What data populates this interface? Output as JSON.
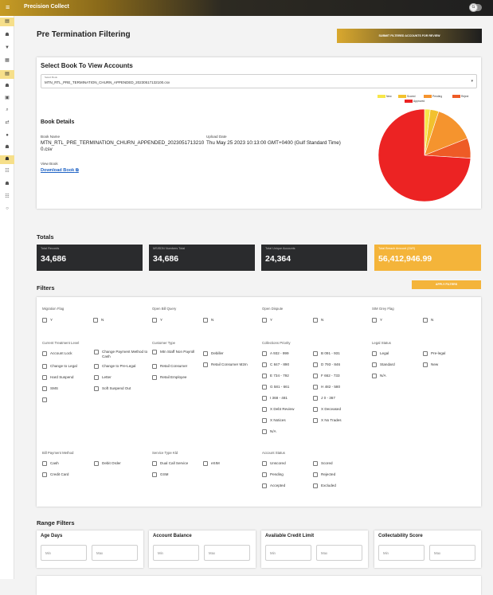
{
  "app": {
    "title": "Precision Collect",
    "avatar_initial": "G"
  },
  "page": {
    "title": "Pre Termination Filtering",
    "submit_label": "SUBMIT FILTERED ACCOUNTS FOR REVIEW"
  },
  "sidebar": {
    "icons": [
      "grid-icon",
      "user-icon",
      "filter-icon",
      "list-icon",
      "book-icon",
      "user-upload-icon",
      "document-icon",
      "search-icon",
      "transfer-icon",
      "pin-icon",
      "person-icon",
      "person-active-icon",
      "group-icon",
      "people-icon",
      "group-2-icon",
      "settings-icon"
    ]
  },
  "book": {
    "heading": "Select Book To View Accounts",
    "select_label": "Select Book",
    "select_value": "MTN_RTL_PRE_TERMINATION_CHURN_APPENDED_20230517132100.csv",
    "details_heading": "Book Details",
    "name_label": "Book Name",
    "name_line1": "MTN_RTL_PRE_TERMINATION_CHURN_APPENDED_2023051713210",
    "name_line2": "0.csv",
    "upload_label": "Upload Date",
    "upload_value": "Thu May 25 2023 10:13:00 GMT+0400 (Gulf Standard Time)",
    "view_label": "View Book",
    "download_label": "Download Book"
  },
  "chart_data": {
    "type": "pie",
    "categories": [
      "New",
      "Scored",
      "Pending",
      "Reject",
      "Approved"
    ],
    "values": [
      2,
      3,
      14,
      7,
      74
    ],
    "colors": [
      "#f7e64a",
      "#f2c12e",
      "#f5942e",
      "#ee5b26",
      "#ec2323"
    ],
    "legend": "top"
  },
  "totals": {
    "heading": "Totals",
    "items": [
      {
        "label": "Total Records",
        "value": "34,686"
      },
      {
        "label": "MSISDN Numbers Total",
        "value": "34,686"
      },
      {
        "label": "Total Unique Accounts",
        "value": "24,364"
      },
      {
        "label": "Total Breach Amount (ZAR)",
        "value": "56,412,946.99"
      }
    ]
  },
  "filters": {
    "heading": "Filters",
    "apply_label": "APPLY FILTERS",
    "migration": {
      "label": "Migration Flag",
      "options": [
        "Y",
        "N"
      ]
    },
    "bill_query": {
      "label": "Open Bill Query",
      "options": [
        "Y",
        "N"
      ]
    },
    "dispute": {
      "label": "Open Dispute",
      "options": [
        "Y",
        "N"
      ]
    },
    "sim_grey": {
      "label": "SIM Grey Flag",
      "options": [
        "Y",
        "N"
      ]
    },
    "treatment": {
      "label": "Current Treatment Level",
      "options": [
        "Account Lock",
        "Change Payment Method to Cash",
        "Change to Legal",
        "Change to Pre-Legal",
        "Hard Suspend",
        "Letter",
        "SMS",
        "Soft Suspend Out",
        ""
      ]
    },
    "customer_type": {
      "label": "Customer Type",
      "options": [
        "Mtn Staff Non Payroll",
        "Debiller",
        "Retail Consumer",
        "Retail Consumer M2m",
        "Retail Employee"
      ]
    },
    "priority": {
      "label": "Collections Priority",
      "options": [
        "A 932 - 999",
        "B 091 - 931",
        "C 847 - 890",
        "D 793 - 846",
        "E 734 - 792",
        "F 662 - 733",
        "G 581 - 661",
        "H 482 - 580",
        "I 368 - 481",
        "J 0 - 367",
        "X Debt Review",
        "X Deceased",
        "X Notices",
        "X No Trades",
        "N/A"
      ]
    },
    "legal": {
      "label": "Legal Status",
      "options": [
        "Legal",
        "Pre-legal",
        "Standard",
        "New",
        "N/A"
      ]
    },
    "payment": {
      "label": "Bill Payment Method",
      "options": [
        "Cash",
        "Debit Order",
        "Credit Card"
      ]
    },
    "service": {
      "label": "Service Type Kld",
      "options": [
        "Dual Call Service",
        "eSIM",
        "GSM"
      ]
    },
    "account_status": {
      "label": "Account Status",
      "options": [
        "Unscored",
        "Scored",
        "Pending",
        "Rejected",
        "Accepted",
        "Excluded"
      ]
    }
  },
  "range": {
    "heading": "Range Filters",
    "items": [
      {
        "label": "Age Days",
        "min": "Min",
        "max": "Max"
      },
      {
        "label": "Account Balance",
        "min": "Min",
        "max": "Max"
      },
      {
        "label": "Available Credit Limit",
        "min": "Min",
        "max": "Max"
      },
      {
        "label": "Collectability Score",
        "min": "Min",
        "max": "Max"
      }
    ]
  }
}
